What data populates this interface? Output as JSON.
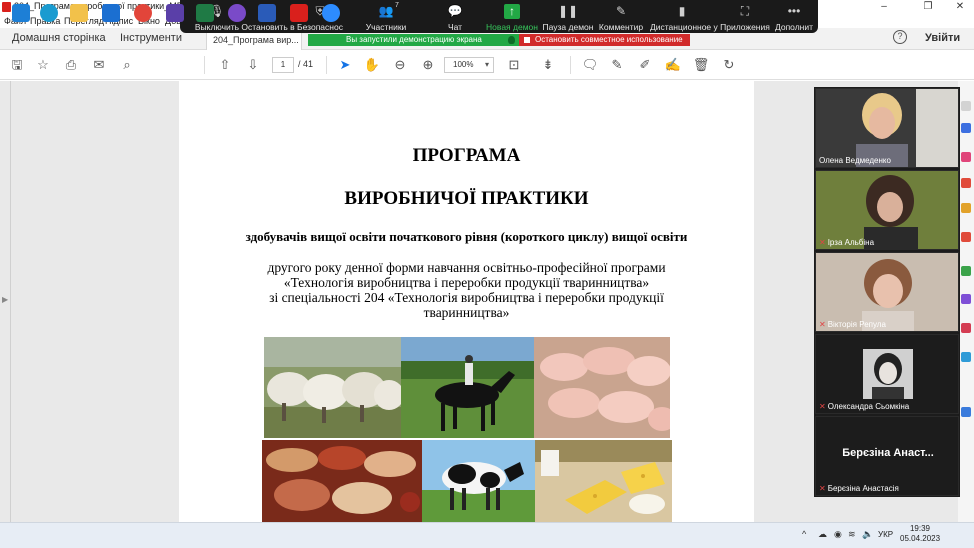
{
  "window": {
    "title": "204_Програма виробничої практики_МБ.pdf - A",
    "minimize": "–",
    "maximize": "❐",
    "close": "✕"
  },
  "menu": [
    "Файл",
    "Правка",
    "Перегляд",
    "Підпис",
    "Вікно",
    "Дов"
  ],
  "zoom_toolbar": {
    "items": [
      {
        "label": "Выключить",
        "icon": "microphone-icon"
      },
      {
        "label": "Остановить в",
        "icon": "video-icon"
      },
      {
        "label": "Безопаснос",
        "icon": "shield-icon"
      },
      {
        "label": "Участники",
        "icon": "participants-icon",
        "count": "7"
      },
      {
        "label": "Чат",
        "icon": "chat-icon"
      },
      {
        "label": "Новая демон",
        "icon": "share-screen-icon"
      },
      {
        "label": "Пауза демон",
        "icon": "pause-icon"
      },
      {
        "label": "Комментир",
        "icon": "annotate-icon"
      },
      {
        "label": "Дистанционное у",
        "icon": "remote-control-icon"
      },
      {
        "label": "Приложения",
        "icon": "apps-icon"
      },
      {
        "label": "Дополнит",
        "icon": "more-icon"
      }
    ]
  },
  "tabs": {
    "home": "Домашня сторінка",
    "tools": "Інструменти",
    "document": "204_Програма вир..."
  },
  "share_banner": {
    "status": "Вы запустили демонстрацию экрана",
    "stop": "Остановить совместное использование",
    "status_color": "#22a845",
    "stop_color": "#d12b2b"
  },
  "help_label": "?",
  "signin_label": "Увійти",
  "pdf_toolbar": {
    "current_page": "1",
    "total_pages": "/ 41",
    "zoom": "100%"
  },
  "document": {
    "title1": "ПРОГРАМА",
    "title2": "ВИРОБНИЧОЇ ПРАКТИКИ",
    "subtitle": "здобувачів вищої освіти початкового рівня (короткого циклу) вищої освіти",
    "line1": "другого року денної форми навчання освітньо-професійної програми",
    "line2": "«Технологія виробництва і переробки продукції тваринництва»",
    "line3": "зі спеціальності 204 «Технологія виробництва і переробки продукції",
    "line4": "тваринництва»"
  },
  "participants": [
    {
      "name": "Олена Ведмеденко",
      "muted": false
    },
    {
      "name": "Ірза Альбіна",
      "muted": true
    },
    {
      "name": "Вікторія Репула",
      "muted": true
    },
    {
      "name": "Олександра Сьомкіна",
      "muted": true
    },
    {
      "name": "Берєзіна Анастасія",
      "display": "Берєзіна Анаст...",
      "muted": true
    }
  ],
  "taskbar": {
    "language": "УКР",
    "time": "19:39",
    "date": "05.04.2023",
    "chevron": "^"
  }
}
